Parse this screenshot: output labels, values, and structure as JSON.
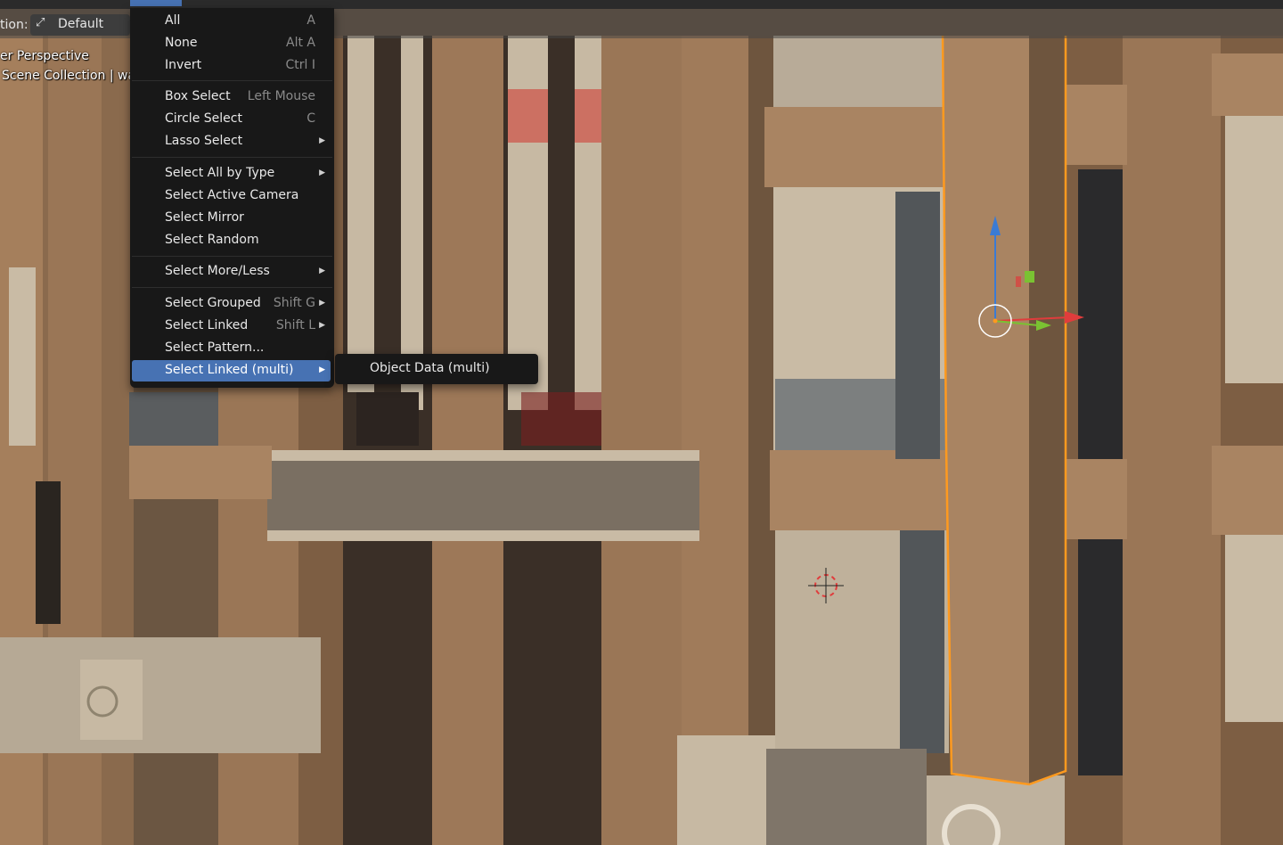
{
  "header": {
    "orientation_prefix": "tion:",
    "orientation_value": "Default"
  },
  "viewport_overlay": {
    "view_name": "er Perspective",
    "collection": "Scene Collection | wal"
  },
  "select_menu": {
    "items": [
      {
        "label": "All",
        "shortcut": "A"
      },
      {
        "label": "None",
        "shortcut": "Alt A"
      },
      {
        "label": "Invert",
        "shortcut": "Ctrl I"
      },
      {
        "label": "Box Select",
        "shortcut": "Left Mouse"
      },
      {
        "label": "Circle Select",
        "shortcut": "C"
      },
      {
        "label": "Lasso Select",
        "shortcut": ""
      },
      {
        "label": "Select All by Type",
        "shortcut": ""
      },
      {
        "label": "Select Active Camera",
        "shortcut": ""
      },
      {
        "label": "Select Mirror",
        "shortcut": ""
      },
      {
        "label": "Select Random",
        "shortcut": ""
      },
      {
        "label": "Select More/Less",
        "shortcut": ""
      },
      {
        "label": "Select Grouped",
        "shortcut": "Shift G"
      },
      {
        "label": "Select Linked",
        "shortcut": "Shift L"
      },
      {
        "label": "Select Pattern...",
        "shortcut": ""
      },
      {
        "label": "Select Linked (multi)",
        "shortcut": ""
      }
    ],
    "active_item": "Select Linked (multi)"
  },
  "submenu": {
    "items": [
      {
        "label": "Object Data (multi)"
      }
    ]
  },
  "colors": {
    "menu_bg": "#181818",
    "menu_highlight": "#4772b3",
    "selection_outline": "#ff9a1f",
    "facade_brown": "#9a7656",
    "gizmo_z": "#3a7bd5",
    "gizmo_x": "#e03c3c",
    "gizmo_y": "#7ac232"
  }
}
